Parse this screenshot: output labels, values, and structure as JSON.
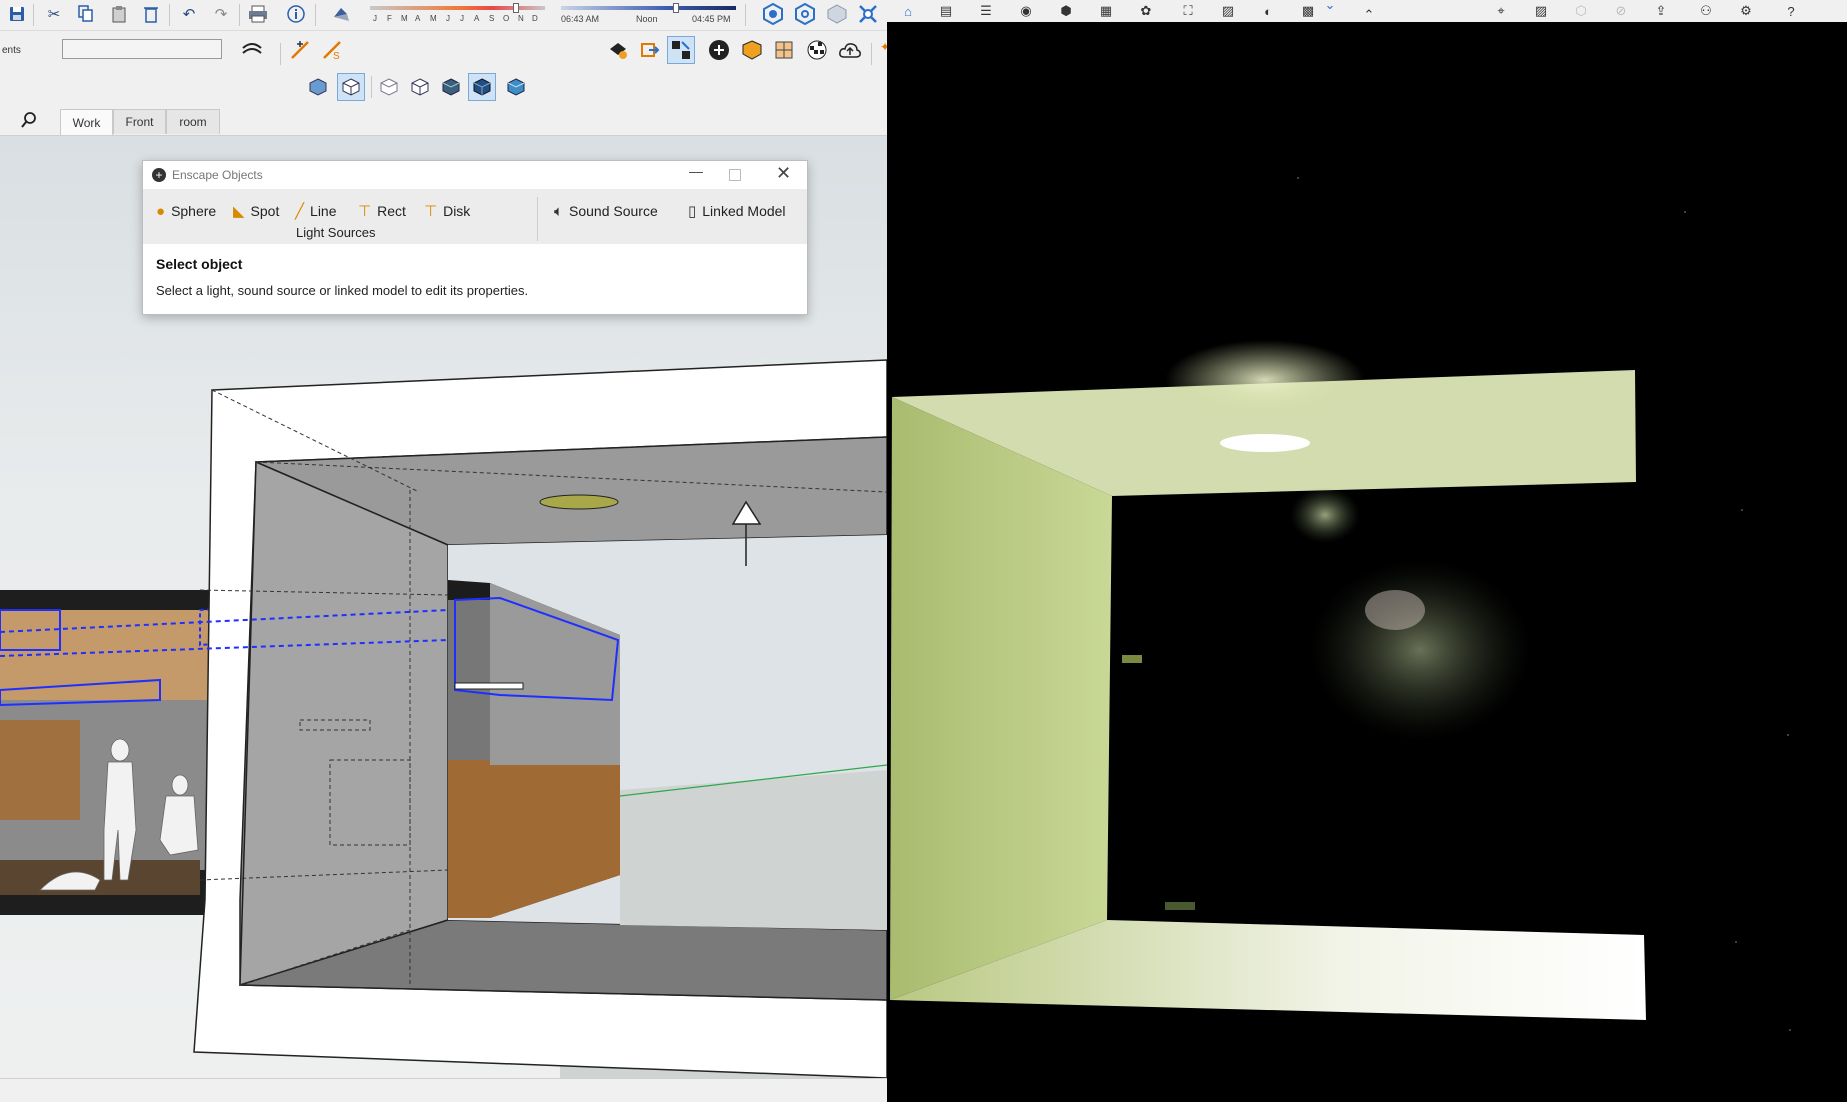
{
  "sketchup": {
    "toolbar_top": {
      "shadow_months": [
        "J",
        "F",
        "M",
        "A",
        "M",
        "J",
        "J",
        "A",
        "S",
        "O",
        "N",
        "D"
      ],
      "time_start": "06:43 AM",
      "time_noon": "Noon",
      "time_end": "04:45 PM"
    },
    "layer_field": {
      "label": "ents",
      "value": ""
    },
    "scene_tabs": [
      {
        "label": "Work"
      },
      {
        "label": "Front"
      },
      {
        "label": "room"
      }
    ]
  },
  "enscape_dialog": {
    "title": "Enscape Objects",
    "buttons": {
      "sphere": "Sphere",
      "spot": "Spot",
      "line": "Line",
      "rect": "Rect",
      "disk": "Disk",
      "sound_source": "Sound Source",
      "linked_model": "Linked Model"
    },
    "group_label": "Light Sources",
    "heading": "Select object",
    "description": "Select a light, sound source or linked model to edit its properties."
  },
  "colors": {
    "accent_blue": "#2a6fc9",
    "selection_blue": "#1f2fff",
    "green_axis": "#2fa84a",
    "room_light": "#c9d8a0",
    "light_disk": "#a8a84a"
  }
}
